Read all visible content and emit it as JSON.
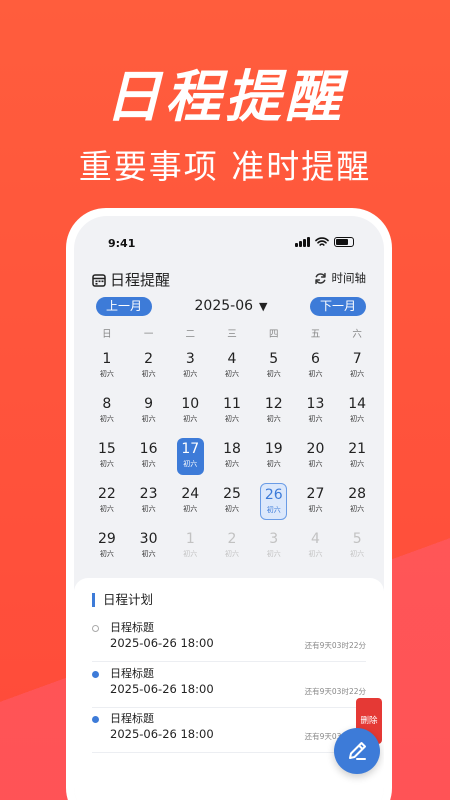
{
  "promo": {
    "headline": "日程提醒",
    "subheadline": "重要事项 准时提醒"
  },
  "status_bar": {
    "time": "9:41"
  },
  "header": {
    "title": "日程提醒",
    "timeline_label": "时间轴"
  },
  "calendar": {
    "prev_label": "上一月",
    "next_label": "下一月",
    "month": "2025-06",
    "month_dropdown_icon": "▼",
    "weekdays": [
      "日",
      "一",
      "二",
      "三",
      "四",
      "五",
      "六"
    ],
    "weeks": [
      [
        {
          "n": "1",
          "l": "初六"
        },
        {
          "n": "2",
          "l": "初六"
        },
        {
          "n": "3",
          "l": "初六"
        },
        {
          "n": "4",
          "l": "初六"
        },
        {
          "n": "5",
          "l": "初六"
        },
        {
          "n": "6",
          "l": "初六"
        },
        {
          "n": "7",
          "l": "初六"
        }
      ],
      [
        {
          "n": "8",
          "l": "初六"
        },
        {
          "n": "9",
          "l": "初六"
        },
        {
          "n": "10",
          "l": "初六"
        },
        {
          "n": "11",
          "l": "初六"
        },
        {
          "n": "12",
          "l": "初六"
        },
        {
          "n": "13",
          "l": "初六"
        },
        {
          "n": "14",
          "l": "初六"
        }
      ],
      [
        {
          "n": "15",
          "l": "初六"
        },
        {
          "n": "16",
          "l": "初六"
        },
        {
          "n": "17",
          "l": "初六",
          "state": "selected"
        },
        {
          "n": "18",
          "l": "初六"
        },
        {
          "n": "19",
          "l": "初六"
        },
        {
          "n": "20",
          "l": "初六"
        },
        {
          "n": "21",
          "l": "初六"
        }
      ],
      [
        {
          "n": "22",
          "l": "初六"
        },
        {
          "n": "23",
          "l": "初六"
        },
        {
          "n": "24",
          "l": "初六"
        },
        {
          "n": "25",
          "l": "初六"
        },
        {
          "n": "26",
          "l": "初六",
          "state": "today"
        },
        {
          "n": "27",
          "l": "初六"
        },
        {
          "n": "28",
          "l": "初六"
        }
      ],
      [
        {
          "n": "29",
          "l": "初六"
        },
        {
          "n": "30",
          "l": "初六"
        },
        {
          "n": "1",
          "l": "初六",
          "state": "dim"
        },
        {
          "n": "2",
          "l": "初六",
          "state": "dim"
        },
        {
          "n": "3",
          "l": "初六",
          "state": "dim"
        },
        {
          "n": "4",
          "l": "初六",
          "state": "dim"
        },
        {
          "n": "5",
          "l": "初六",
          "state": "dim"
        }
      ]
    ]
  },
  "schedule": {
    "title": "日程计划",
    "items": [
      {
        "title": "日程标题",
        "datetime": "2025-06-26 18:00",
        "remaining": "还有9天03时22分",
        "marker": "hollow"
      },
      {
        "title": "日程标题",
        "datetime": "2025-06-26 18:00",
        "remaining": "还有9天03时22分",
        "marker": "filled"
      },
      {
        "title": "日程标题",
        "datetime": "2025-06-26 18:00",
        "remaining": "还有9天03时22分",
        "marker": "filled"
      }
    ],
    "delete_label": "删除"
  },
  "icons": {
    "calendar": "calendar-icon",
    "refresh": "refresh-icon",
    "edit": "pencil-icon"
  },
  "colors": {
    "accent": "#3d7bd8",
    "background": "#ff5d3d",
    "delete": "#e53935"
  }
}
